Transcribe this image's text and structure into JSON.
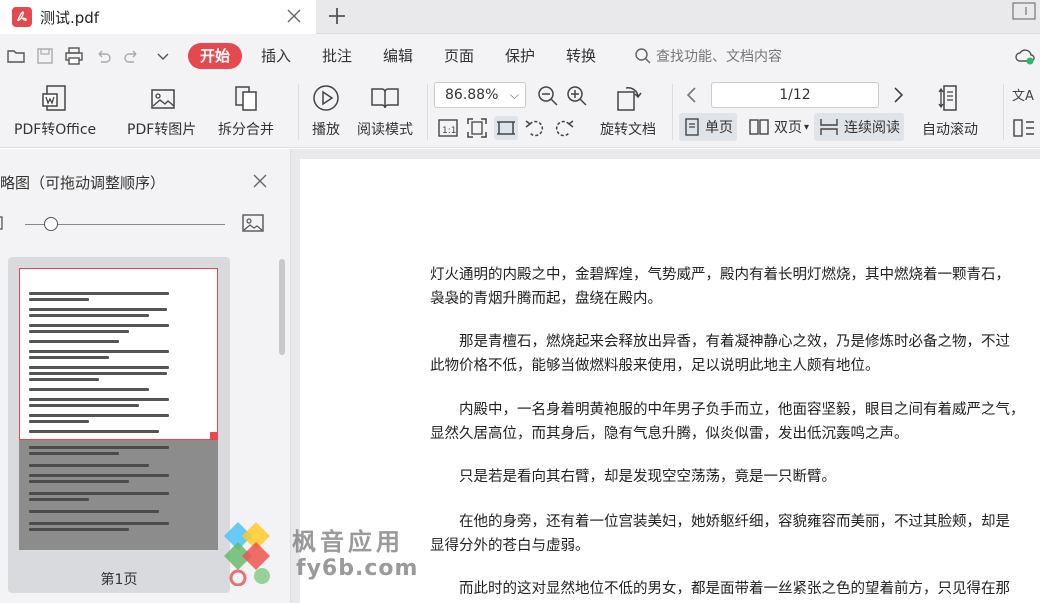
{
  "tab": {
    "title": "测试.pdf"
  },
  "menu": {
    "items": [
      "开始",
      "插入",
      "批注",
      "编辑",
      "页面",
      "保护",
      "转换"
    ],
    "active_index": 0,
    "search_placeholder": "查找功能、文档内容"
  },
  "toolbar": {
    "pdf_to_office": "PDF转Office",
    "pdf_to_image": "PDF转图片",
    "split_merge": "拆分合并",
    "play": "播放",
    "read_mode": "阅读模式",
    "zoom_value": "86.88%",
    "rotate_doc": "旋转文档",
    "page_indicator": "1/12",
    "single_page": "单页",
    "double_page": "双页",
    "continuous": "连续阅读",
    "auto_scroll": "自动滚动"
  },
  "sidebar": {
    "title": "略图（可拖动调整顺序）",
    "page_label": "第1页",
    "slider_level": 0.13
  },
  "document": {
    "paragraphs": [
      {
        "line1": "灯火通明的内殿之中，金碧辉煌，气势威严，殿内有着长明灯燃烧，其中燃烧着一颗青石，",
        "line2": "袅袅的青烟升腾而起，盘绕在殿内。"
      },
      {
        "line1": "那是青檀石，燃烧起来会释放出异香，有着凝神静心之效，乃是修炼时必备之物，不过",
        "line2": "此物价格不低，能够当做燃料般来使用，足以说明此地主人颇有地位。"
      },
      {
        "line1": "内殿中，一名身着明黄袍服的中年男子负手而立，他面容坚毅，眼目之间有着威严之气，",
        "line2": "显然久居高位，而其身后，隐有气息升腾，似炎似雷，发出低沉轰鸣之声。"
      },
      {
        "line1": "只是若是看向其右臂，却是发现空空荡荡，竟是一只断臂。",
        "line2": ""
      },
      {
        "line1": "在他的身旁，还有着一位宫装美妇，她娇躯纤细，容貌雍容而美丽，不过其脸颊，却是",
        "line2": "显得分外的苍白与虚弱。"
      },
      {
        "line1": "而此时的这对显然地位不低的男女，都是面带着一丝紧张之色的望着前方，只见得在那",
        "line2": ""
      }
    ]
  },
  "watermark": {
    "brand": "枫音应用",
    "domain": "fy6b.com"
  },
  "colors": {
    "accent": "#e5484d",
    "chrome_bg": "#f3f3f5",
    "tab_bar_bg": "#e9e9ec"
  }
}
